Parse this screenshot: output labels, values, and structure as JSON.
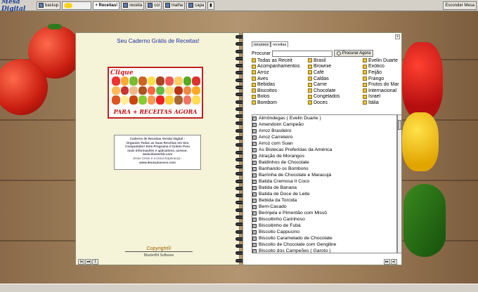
{
  "taskbar": {
    "logo": "Mesa Digital",
    "buttons": [
      "backup",
      "+ Receitas!",
      "receita",
      "coi",
      "malha",
      "capa"
    ],
    "right": "Esconder Mesa"
  },
  "left": {
    "title": "Seu Caderno Grátis de Receitas!",
    "promo_top": "Clique",
    "promo_bottom": "PARA + RECEITAS AGORA",
    "info_lines": [
      "Caderno de Receitas Versão Digital -",
      "Organize Todas as Suas Receitas em Seu",
      "Computador! Este Programa é Grátis! Para",
      "mais informações e aplicativos, acesse:",
      "www.blasterbit.com",
      "Jesus Cristo é a Única Esperança -",
      "www.deusamavoce.com"
    ],
    "copyright": "Copyright®",
    "software": "BlasterBit Software"
  },
  "right": {
    "tabs": [
      "recursos",
      "receitas"
    ],
    "search_label": "Procurar",
    "search_button": "Procurar Agora",
    "categories": [
      "Todas as Receit",
      "Acompanhamentos",
      "Arroz",
      "Aves",
      "Bebidas",
      "Biscoitos",
      "Bolos",
      "Bombom",
      "Brasil",
      "Brownie",
      "Café",
      "Caldas",
      "Carne",
      "Chocolate",
      "Congelados",
      "Doces",
      "Evelin Duarte",
      "Exótico",
      "Feijão",
      "Frango",
      "Frutos do Mar",
      "Internacional",
      "Israel",
      "Itália"
    ],
    "recipes": [
      "Almôndegas ( Evelin Duarte )",
      "Amendoim Campeão",
      "Arroz Brasileiro",
      "Arroz Carreteiro",
      "Arroz com Suan",
      "As Bistecas Preferidas da América",
      "Atração de Morangos",
      "Baldinhos de Chocolate",
      "Banhando os Bombons",
      "Barrinha de Chocolate e Maracujá",
      "Batida Cremosa II Coco",
      "Batida de Banana",
      "Batida de Doce de Leite",
      "Bebida da Torcida",
      "Bem-Casado",
      "Berinjela e Pimentão com Missô",
      "Biscoitinho Carinhoso",
      "Biscoitinho de Fubá",
      "Biscoito Cappucino",
      "Biscoito Caramelado de Chocolate",
      "Biscoito de Chocolate com Gengibre",
      "Biscoito dos Campeões ( Garoto )",
      "Biscoitos Craquelados"
    ]
  }
}
